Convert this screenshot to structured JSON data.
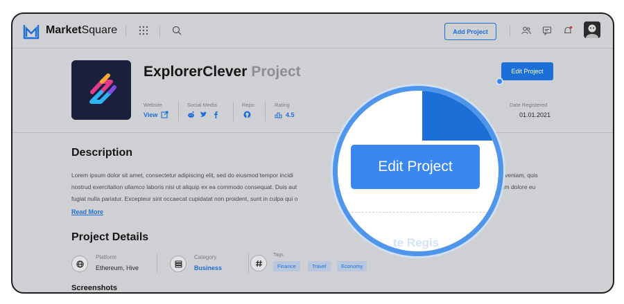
{
  "topbar": {
    "brand_bold": "Market",
    "brand_rest": "Square",
    "add_project_label": "Add Project",
    "icons": [
      "logo-icon",
      "apps-grid-icon",
      "search-icon",
      "users-icon",
      "chat-icon",
      "bell-icon",
      "avatar"
    ]
  },
  "project": {
    "name": "ExplorerClever",
    "suffix": "Project",
    "edit_label": "Edit Project",
    "meta": {
      "website_label": "Website",
      "website_value": "View",
      "social_label": "Social Media",
      "repo_label": "Repo",
      "rating_label": "Rating",
      "rating_value": "4.5",
      "date_label": "Date Registered",
      "date_value": "01.01.2021"
    }
  },
  "description": {
    "heading": "Description",
    "line1_left": "Lorem ipsum dolor sit amet, consectetur adipiscing elit, sed do eiusmod tempor incidi",
    "line1_right": "n veniam, quis",
    "line2_left": "nostrud exercitation ullamco laboris nisi ut aliquip ex ea commodo consequat. Duis aut",
    "line2_right": "llum dolore eu",
    "line3_left": "fugiat nulla pariatur. Excepteur sint occaecat cupidatat non proident, sunt in culpa qui o",
    "read_more": "Read More"
  },
  "details": {
    "heading": "Project Details",
    "platform_label": "Platform",
    "platform_value": "Ethereum, Hive",
    "category_label": "Category",
    "category_value": "Business",
    "tags_label": "Tags",
    "tags": [
      "Finance",
      "Travel",
      "Economy"
    ]
  },
  "screenshots": {
    "heading": "Screenshots"
  },
  "magnifier": {
    "button_label": "Edit Project",
    "ghost_text": "te Regis"
  },
  "colors": {
    "accent": "#1d6fd8",
    "magnifier_button": "#3a87f2",
    "overlay": "#cfd0d3"
  }
}
